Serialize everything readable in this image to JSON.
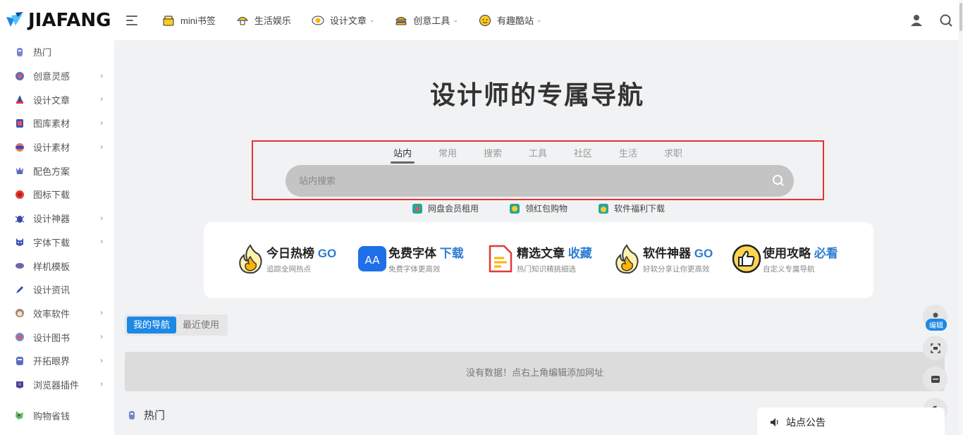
{
  "logo": {
    "text": "JIAFANG",
    "icon": "jiafang-logo-icon"
  },
  "top_nav": [
    {
      "label": "mini书签",
      "icon": "box-icon",
      "dropdown": false
    },
    {
      "label": "生活娱乐",
      "icon": "mushroom-icon",
      "dropdown": false
    },
    {
      "label": "设计文章",
      "icon": "egg-icon",
      "dropdown": true
    },
    {
      "label": "创意工具",
      "icon": "burger-icon",
      "dropdown": true
    },
    {
      "label": "有趣酷站",
      "icon": "smiley-icon",
      "dropdown": true
    }
  ],
  "sidebar": {
    "items": [
      {
        "label": "热门",
        "icon": "hot-icon",
        "arrow": false
      },
      {
        "label": "创意灵感",
        "icon": "lightbulb-icon",
        "arrow": true
      },
      {
        "label": "设计文章",
        "icon": "wizard-icon",
        "arrow": true
      },
      {
        "label": "图库素材",
        "icon": "gallery-icon",
        "arrow": true
      },
      {
        "label": "设计素材",
        "icon": "planet-icon",
        "arrow": true
      },
      {
        "label": "配色方案",
        "icon": "palette-icon",
        "arrow": false
      },
      {
        "label": "图标下载",
        "icon": "icon-download-icon",
        "arrow": false
      },
      {
        "label": "设计神器",
        "icon": "bug-icon",
        "arrow": true
      },
      {
        "label": "字体下载",
        "icon": "font-icon",
        "arrow": true
      },
      {
        "label": "样机模板",
        "icon": "mockup-icon",
        "arrow": false
      },
      {
        "label": "设计资讯",
        "icon": "news-icon",
        "arrow": false
      },
      {
        "label": "效率软件",
        "icon": "monkey-icon",
        "arrow": true
      },
      {
        "label": "设计图书",
        "icon": "book-icon",
        "arrow": true
      },
      {
        "label": "开拓眼界",
        "icon": "eye-icon",
        "arrow": true
      },
      {
        "label": "浏览器插件",
        "icon": "browser-icon",
        "arrow": true
      },
      {
        "label": "购物省钱",
        "icon": "shopping-icon",
        "arrow": false
      }
    ]
  },
  "hero": {
    "title": "设计师的专属导航"
  },
  "search": {
    "tabs": [
      "站内",
      "常用",
      "搜索",
      "工具",
      "社区",
      "生活",
      "求职"
    ],
    "active_tab": "站内",
    "placeholder": "站内搜索",
    "value": ""
  },
  "quick_links": [
    {
      "label": "网盘会员租用",
      "icon": "cloud-disk-icon"
    },
    {
      "label": "领红包购物",
      "icon": "red-packet-icon"
    },
    {
      "label": "软件福利下载",
      "icon": "software-gift-icon"
    }
  ],
  "features": [
    {
      "title": "今日热榜",
      "highlight": "GO",
      "subtitle": "追踪全网热点",
      "icon": "fire-icon"
    },
    {
      "title": "免费字体",
      "highlight": "下载",
      "subtitle": "免费字体更高效",
      "icon": "font-aa-icon"
    },
    {
      "title": "精选文章",
      "highlight": "收藏",
      "subtitle": "热门知识精挑细选",
      "icon": "document-icon"
    },
    {
      "title": "软件神器",
      "highlight": "GO",
      "subtitle": "好软分享让你更高效",
      "icon": "fire-icon"
    },
    {
      "title": "使用攻略",
      "highlight": "必看",
      "subtitle": "自定义专属导航",
      "icon": "thumbs-up-icon"
    }
  ],
  "my_nav": {
    "tabs": [
      "我的导航",
      "最近使用"
    ],
    "active_tab": "我的导航",
    "empty_text": "没有数据！点右上角编辑添加网址"
  },
  "section": {
    "title": "热门",
    "icon": "hot-icon"
  },
  "float_buttons": [
    {
      "name": "user",
      "icon": "user-icon",
      "badge": "编辑"
    },
    {
      "name": "scan",
      "icon": "scan-icon"
    },
    {
      "name": "dock",
      "icon": "dock-icon"
    },
    {
      "name": "theme",
      "icon": "moon-icon"
    }
  ],
  "notice": {
    "title": "站点公告",
    "icon": "speaker-icon"
  },
  "colors": {
    "accent": "#1e88e5",
    "highlight_text": "#2e7dd1",
    "search_border": "#e53333"
  }
}
